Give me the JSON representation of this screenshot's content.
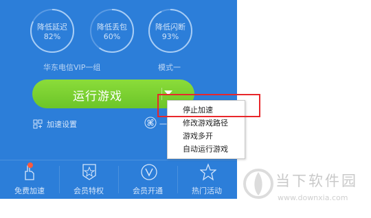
{
  "gauges": [
    {
      "label": "降低延迟",
      "value": "82%"
    },
    {
      "label": "降低丢包",
      "value": "60%"
    },
    {
      "label": "降低闪断",
      "value": "93%"
    }
  ],
  "server": {
    "line": "华东电信VIP一组",
    "mode": "模式一"
  },
  "run_button": {
    "label": "运行游戏"
  },
  "accel_setting": {
    "label": "加速设置"
  },
  "fan_text": "一",
  "context_menu": {
    "items": [
      "停止加速",
      "修改游戏路径",
      "游戏多开",
      "自动运行游戏"
    ]
  },
  "bottom_nav": [
    {
      "label": "免费加速",
      "icon": "hand-icon"
    },
    {
      "label": "会员特权",
      "icon": "star-badge-icon"
    },
    {
      "label": "会员开通",
      "icon": "vip-v-icon"
    },
    {
      "label": "热门活动",
      "icon": "star-icon"
    }
  ],
  "watermark": {
    "title": "当下软件园",
    "url": "www.downxia.com"
  },
  "colors": {
    "panel": "#2c7ed9",
    "button": "#7ccf30",
    "highlight": "#e8262a"
  }
}
